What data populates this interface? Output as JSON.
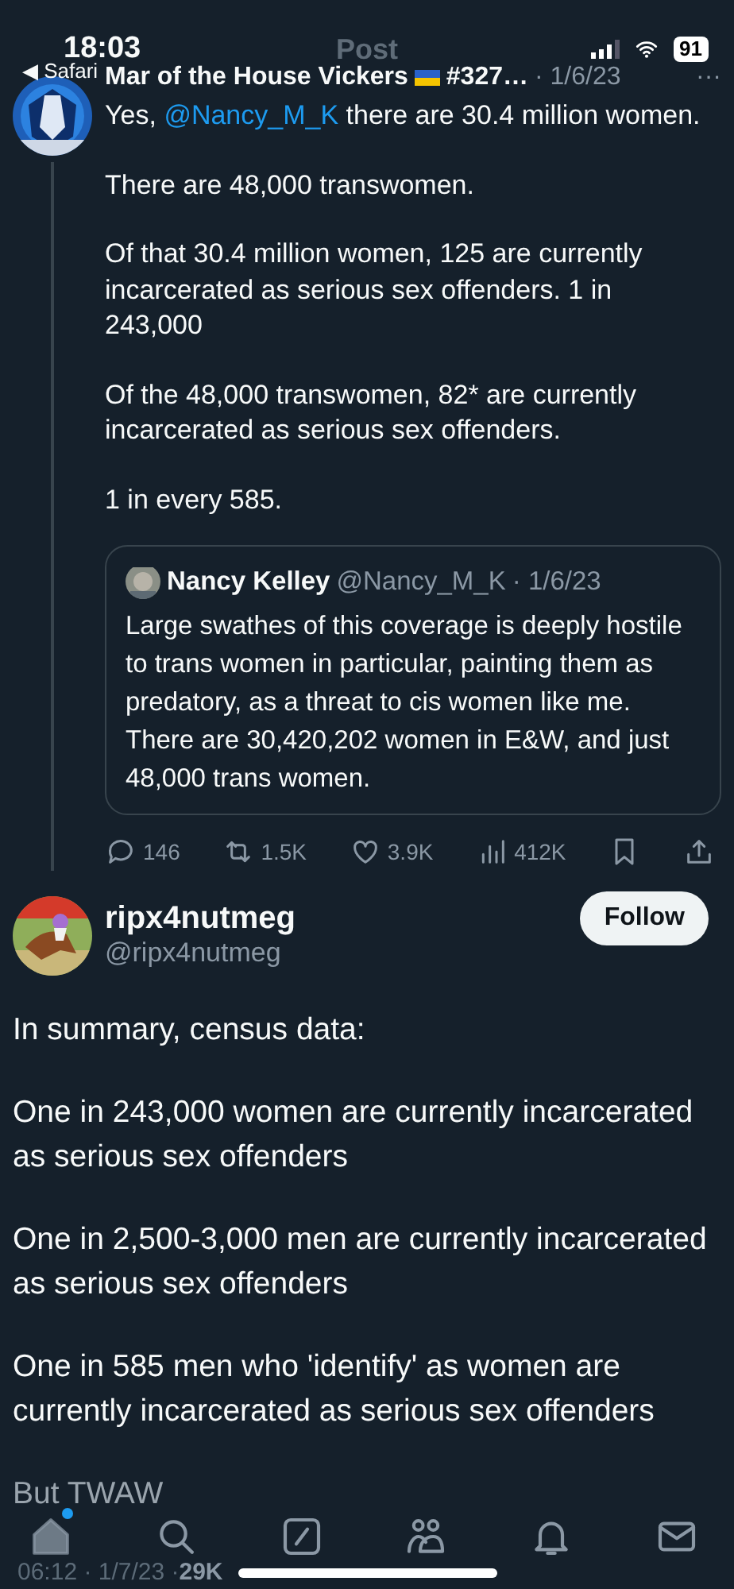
{
  "status_bar": {
    "time": "18:03",
    "back": "◀ Safari",
    "battery": "91"
  },
  "header": {
    "title": "Post"
  },
  "reply": {
    "author": "Mar of the House Vickers",
    "author_suffix": "#327…",
    "date": "· 1/6/23",
    "more": "···",
    "paragraphs": [
      {
        "mention": "@Nancy_M_K",
        "before": "Yes, ",
        "after": "  there are 30.4 million women."
      },
      {
        "text": "There are 48,000 transwomen."
      },
      {
        "text": "Of that 30.4 million women, 125 are currently incarcerated as serious sex offenders. 1 in 243,000"
      },
      {
        "text": "Of the 48,000 transwomen, 82* are currently incarcerated as serious sex offenders."
      },
      {
        "text": "1 in every 585."
      }
    ],
    "quote": {
      "name": "Nancy Kelley",
      "handle": "@Nancy_M_K",
      "date": "· 1/6/23",
      "text": "Large swathes of this coverage is deeply hostile to trans women in particular, painting them as predatory, as a threat to cis women like me. There are 30,420,202 women in E&W, and just 48,000 trans women."
    },
    "actions": [
      {
        "kind": "reply",
        "count": "146"
      },
      {
        "kind": "repost",
        "count": "1.5K"
      },
      {
        "kind": "like",
        "count": "3.9K"
      },
      {
        "kind": "views",
        "count": "412K"
      },
      {
        "kind": "bookmark"
      },
      {
        "kind": "share"
      }
    ]
  },
  "post": {
    "name": "ripx4nutmeg",
    "handle": "@ripx4nutmeg",
    "follow": "Follow",
    "paragraphs": [
      "In summary, census data:",
      "One in 243,000 women are currently incarcerated as serious sex offenders",
      "One in 2,500-3,000 men are currently incarcerated as serious sex offenders",
      "One in 585 men who 'identify' as women are currently incarcerated as serious sex offenders",
      "But TWAW"
    ],
    "meta": "06:12 · 1/7/23 · ",
    "views": "29K"
  },
  "tab_bar": [
    {
      "kind": "home",
      "selected": true,
      "badge": true
    },
    {
      "kind": "search",
      "selected": false,
      "badge": false
    },
    {
      "kind": "compose",
      "selected": false,
      "badge": false
    },
    {
      "kind": "communities",
      "selected": false,
      "badge": false
    },
    {
      "kind": "notifications",
      "selected": false,
      "badge": false
    },
    {
      "kind": "messages",
      "selected": false,
      "badge": false
    }
  ]
}
